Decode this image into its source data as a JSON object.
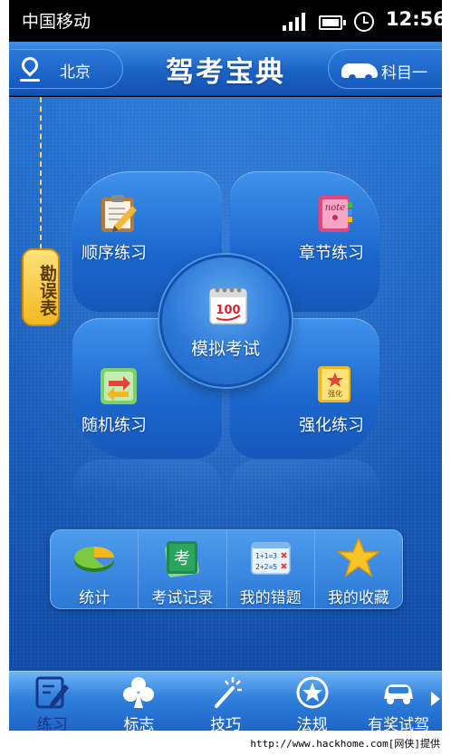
{
  "status_bar": {
    "carrier": "中国移动",
    "time": "12:56"
  },
  "header": {
    "city": "北京",
    "title": "驾考宝典",
    "subject": "科目一"
  },
  "errata": {
    "label": "勘误表"
  },
  "practice_tiles": [
    {
      "label": "顺序练习",
      "icon": "clipboard-pencil-icon"
    },
    {
      "label": "章节练习",
      "icon": "notebook-icon"
    },
    {
      "label": "随机练习",
      "icon": "shuffle-icon"
    },
    {
      "label": "强化练习",
      "icon": "star-book-icon"
    }
  ],
  "mock_exam": {
    "label": "模拟考试",
    "icon": "calendar-100-icon"
  },
  "quick_bar": [
    {
      "label": "统计",
      "icon": "pie-chart-icon"
    },
    {
      "label": "考试记录",
      "icon": "exam-card-icon"
    },
    {
      "label": "我的错题",
      "icon": "math-card-icon"
    },
    {
      "label": "我的收藏",
      "icon": "star-icon"
    }
  ],
  "tab_bar": [
    {
      "label": "练习",
      "icon": "edit-icon",
      "active": true
    },
    {
      "label": "标志",
      "icon": "club-icon"
    },
    {
      "label": "技巧",
      "icon": "magic-wand-icon"
    },
    {
      "label": "法规",
      "icon": "badge-star-icon"
    },
    {
      "label": "有奖试驾",
      "icon": "car-icon"
    }
  ],
  "watermark": "http://www.hackhome.com[网侠]提供",
  "colors": {
    "primary_blue": "#1d67c8",
    "header_blue": "#1b62c6",
    "errata_yellow": "#f2b822",
    "active_tab_text": "#17378a"
  }
}
